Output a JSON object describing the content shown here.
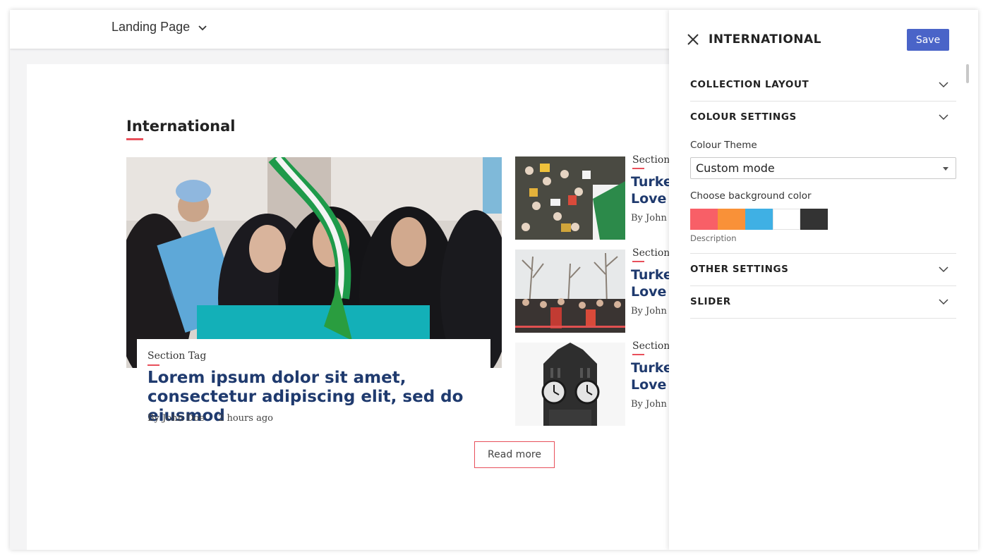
{
  "topbar": {
    "page_selector_label": "Landing Page",
    "page_selector_icon": "chevron-down-icon"
  },
  "content": {
    "section_title": "International",
    "hero": {
      "section_tag": "Section Tag",
      "headline": "Lorem ipsum dolor sit amet, consectetur adipiscing elit, sed do eiusmod",
      "author": "By  John Doe",
      "time": "2 hours ago"
    },
    "side_items": [
      {
        "tag": "Section",
        "headline_line1": "Turkey",
        "headline_line2": "Love fo",
        "meta": "By  John D"
      },
      {
        "tag": "Section",
        "headline_line1": "Turkey",
        "headline_line2": "Love fo",
        "meta": "By  John D"
      },
      {
        "tag": "Section",
        "headline_line1": "Turkey",
        "headline_line2": "Love fo",
        "meta": "By  John D"
      }
    ],
    "read_more_label": "Read more"
  },
  "panel": {
    "title": "INTERNATIONAL",
    "save_label": "Save",
    "accordions": {
      "collection_layout": "COLLECTION LAYOUT",
      "colour_settings": "COLOUR SETTINGS",
      "other_settings": "OTHER SETTINGS",
      "slider": "SLIDER"
    },
    "colour_theme_label": "Colour Theme",
    "colour_theme_value": "Custom mode",
    "background_color_label": "Choose background color",
    "swatches": [
      "#f85f67",
      "#f99138",
      "#3fb0e4",
      "#ffffff",
      "#333333"
    ],
    "description_label": "Description"
  },
  "colors": {
    "accent": "#e8505b",
    "headline": "#1f3a6e",
    "save_button": "#4a64c8"
  }
}
